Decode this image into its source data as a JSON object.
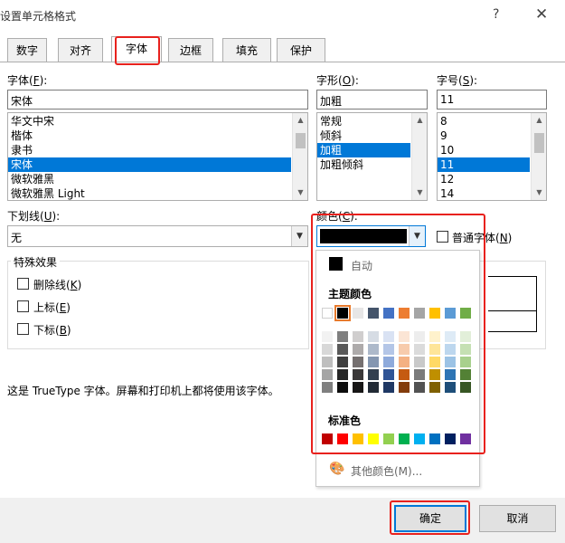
{
  "dialog": {
    "title": "设置单元格格式",
    "help": "?",
    "close": "✕"
  },
  "tabs": [
    "数字",
    "对齐",
    "字体",
    "边框",
    "填充",
    "保护"
  ],
  "font": {
    "label": "字体(",
    "key": "F",
    "label_end": "):",
    "value": "宋体",
    "items": [
      "华文中宋",
      "楷体",
      "隶书",
      "宋体",
      "微软雅黑",
      "微软雅黑 Light"
    ],
    "selected_index": 3
  },
  "style": {
    "label": "字形(",
    "key": "O",
    "label_end": "):",
    "value": "加粗",
    "items": [
      "常规",
      "倾斜",
      "加粗",
      "加粗倾斜"
    ],
    "selected_index": 2
  },
  "size": {
    "label": "字号(",
    "key": "S",
    "label_end": "):",
    "value": "11",
    "items": [
      "8",
      "9",
      "10",
      "11",
      "12",
      "14"
    ],
    "selected_index": 3
  },
  "underline": {
    "label": "下划线(",
    "key": "U",
    "label_end": "):",
    "value": "无"
  },
  "color": {
    "label": "颜色(",
    "key": "C",
    "label_end": "):",
    "value": "#000000"
  },
  "normal_font": {
    "label": "普通字体(",
    "key": "N",
    "label_end": ")"
  },
  "effects": {
    "title": "特殊效果",
    "strike": {
      "label": "删除线(",
      "key": "K",
      "label_end": ")"
    },
    "super": {
      "label": "上标(",
      "key": "E",
      "label_end": ")"
    },
    "sub": {
      "label": "下标(",
      "key": "B",
      "label_end": ")"
    }
  },
  "description": "这是 TrueType 字体。屏幕和打印机上都将使用该字体。",
  "palette": {
    "auto_label": "自动",
    "theme_title": "主题颜色",
    "standard_title": "标准色",
    "more_label": "其他颜色(M)...",
    "theme_top": [
      "#ffffff",
      "#000000",
      "#e7e6e6",
      "#44546a",
      "#4472c4",
      "#ed7d31",
      "#a5a5a5",
      "#ffc000",
      "#5b9bd5",
      "#70ad47"
    ],
    "theme_shades": [
      [
        "#f2f2f2",
        "#7f7f7f",
        "#d0cece",
        "#d6dce4",
        "#d9e2f3",
        "#fbe5d5",
        "#ededed",
        "#fff2cc",
        "#deebf6",
        "#e2efd9"
      ],
      [
        "#d8d8d8",
        "#595959",
        "#aeabab",
        "#adb9ca",
        "#b4c6e7",
        "#f7cbac",
        "#dbdbdb",
        "#fee599",
        "#bdd7ee",
        "#c5e0b3"
      ],
      [
        "#bfbfbf",
        "#3f3f3f",
        "#757070",
        "#8496b0",
        "#8eaadb",
        "#f4b183",
        "#c9c9c9",
        "#ffd965",
        "#9cc3e5",
        "#a8d08d"
      ],
      [
        "#a5a5a5",
        "#262626",
        "#3a3838",
        "#323f4f",
        "#2f5496",
        "#c55a11",
        "#7b7b7b",
        "#bf8f00",
        "#2e75b5",
        "#538135"
      ],
      [
        "#7f7f7f",
        "#0c0c0c",
        "#171616",
        "#222a35",
        "#1f3864",
        "#833c0b",
        "#525252",
        "#7f6000",
        "#1e4e79",
        "#375623"
      ]
    ],
    "standard": [
      "#c00000",
      "#ff0000",
      "#ffc000",
      "#ffff00",
      "#92d050",
      "#00b050",
      "#00b0f0",
      "#0070c0",
      "#002060",
      "#7030a0"
    ]
  },
  "buttons": {
    "ok": "确定",
    "cancel": "取消"
  },
  "accent": "#0078d7",
  "highlight": "#e8211d"
}
